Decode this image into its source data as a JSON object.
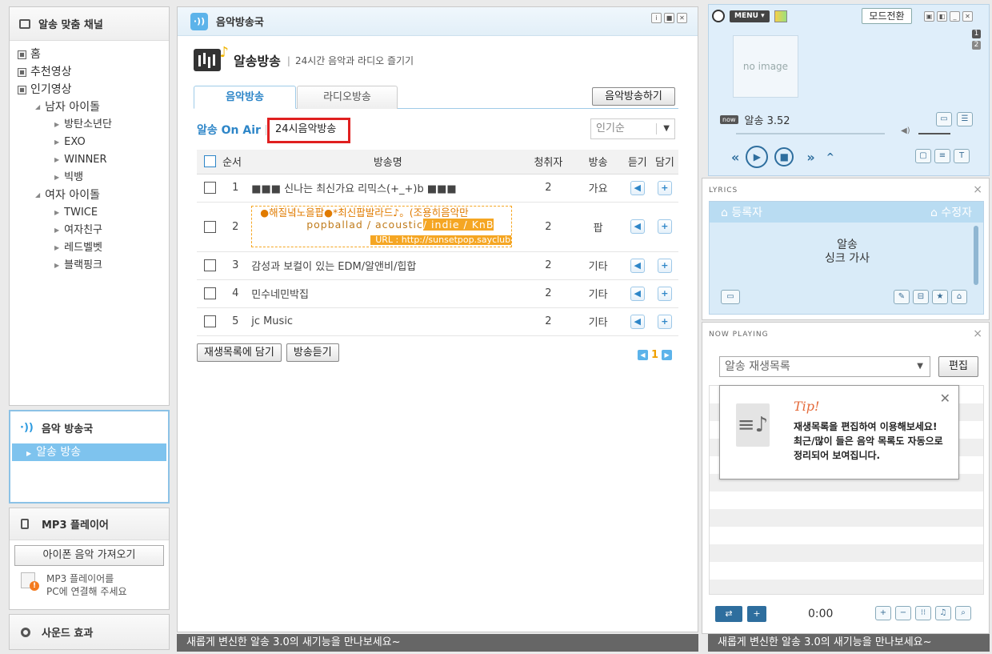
{
  "left": {
    "channel_title": "알송 맞춤 채널",
    "tree": {
      "home": "홈",
      "recommended": "추천영상",
      "popular": "인기영상",
      "male_idols": "남자 아이돌",
      "male": [
        "방탄소년단",
        "EXO",
        "WINNER",
        "빅뱅"
      ],
      "female_idols": "여자 아이돌",
      "female": [
        "TWICE",
        "여자친구",
        "레드벨벳",
        "블랙핑크"
      ]
    },
    "radio_title": "음악 방송국",
    "radio_selected": "알송 방송",
    "mp3_title": "MP3 플레이어",
    "iphone_button": "아이폰 음악 가져오기",
    "mp3_info_line1": "MP3 플레이어를",
    "mp3_info_line2": "PC에 연결해 주세요",
    "sound_effect": "사운드 효과"
  },
  "center": {
    "header_title": "음악방송국",
    "page_title": "알송방송",
    "page_subtitle": "24시간 음악과 라디오 즐기기",
    "tabs": [
      "음악방송",
      "라디오방송"
    ],
    "broadcast_button": "음악방송하기",
    "onair_label": "알송 On Air",
    "onair_channel": "24시음악방송",
    "sort_value": "인기순",
    "columns": {
      "order": "순서",
      "name": "방송명",
      "listeners": "청취자",
      "genre": "방송",
      "listen": "듣기",
      "add": "담기"
    },
    "rows": [
      {
        "num": "1",
        "name": "■■■ 신나는 최신가요 리믹스(+_+)b ■■■",
        "listeners": "2",
        "genre": "가요"
      },
      {
        "num": "2",
        "name": "",
        "listeners": "2",
        "genre": "팝"
      },
      {
        "num": "3",
        "name": "감성과 보컬이 있는 EDM/알앤비/힙합",
        "listeners": "2",
        "genre": "기타"
      },
      {
        "num": "4",
        "name": "민수네민박집",
        "listeners": "2",
        "genre": "기타"
      },
      {
        "num": "5",
        "name": "jc Music",
        "listeners": "2",
        "genre": "기타"
      }
    ],
    "promo": {
      "line1": "●해질녘노을팝●*최신팝발라드♪。(조용히음악만",
      "line2a": "popballad / acoustic",
      "line2b": "/ indie / KnB",
      "line3": "URL : http://sunsetpop.sayclub"
    },
    "add_playlist_button": "재생목록에 담기",
    "listen_button": "방송듣기",
    "page": "1",
    "footer": "새롭게 변신한 알송 3.0의 새기능을 만나보세요~"
  },
  "player": {
    "menu_label": "MENU",
    "mode_button": "모드전환",
    "no_image": "no image",
    "now_badge": "now",
    "now_title": "알송 3.52",
    "page_numbers": [
      "1",
      "2"
    ]
  },
  "lyrics": {
    "section": "LYRICS",
    "registrant": "등록자",
    "editor": "수정자",
    "line1": "알송",
    "line2": "싱크 가사"
  },
  "nowplaying": {
    "section": "NOW PLAYING",
    "playlist": "알송 재생목록",
    "edit_button": "편집",
    "tip_title": "Tip!",
    "tip_line1": "재생목록을 편집하여 이용해보세요!",
    "tip_line2": "최근/많이 들은 음악 목록도 자동으로",
    "tip_line3": "정리되어 보여집니다.",
    "time": "0:00",
    "footer": "새롭게 변신한 알송 3.0의 새기능을 만나보세요~"
  }
}
